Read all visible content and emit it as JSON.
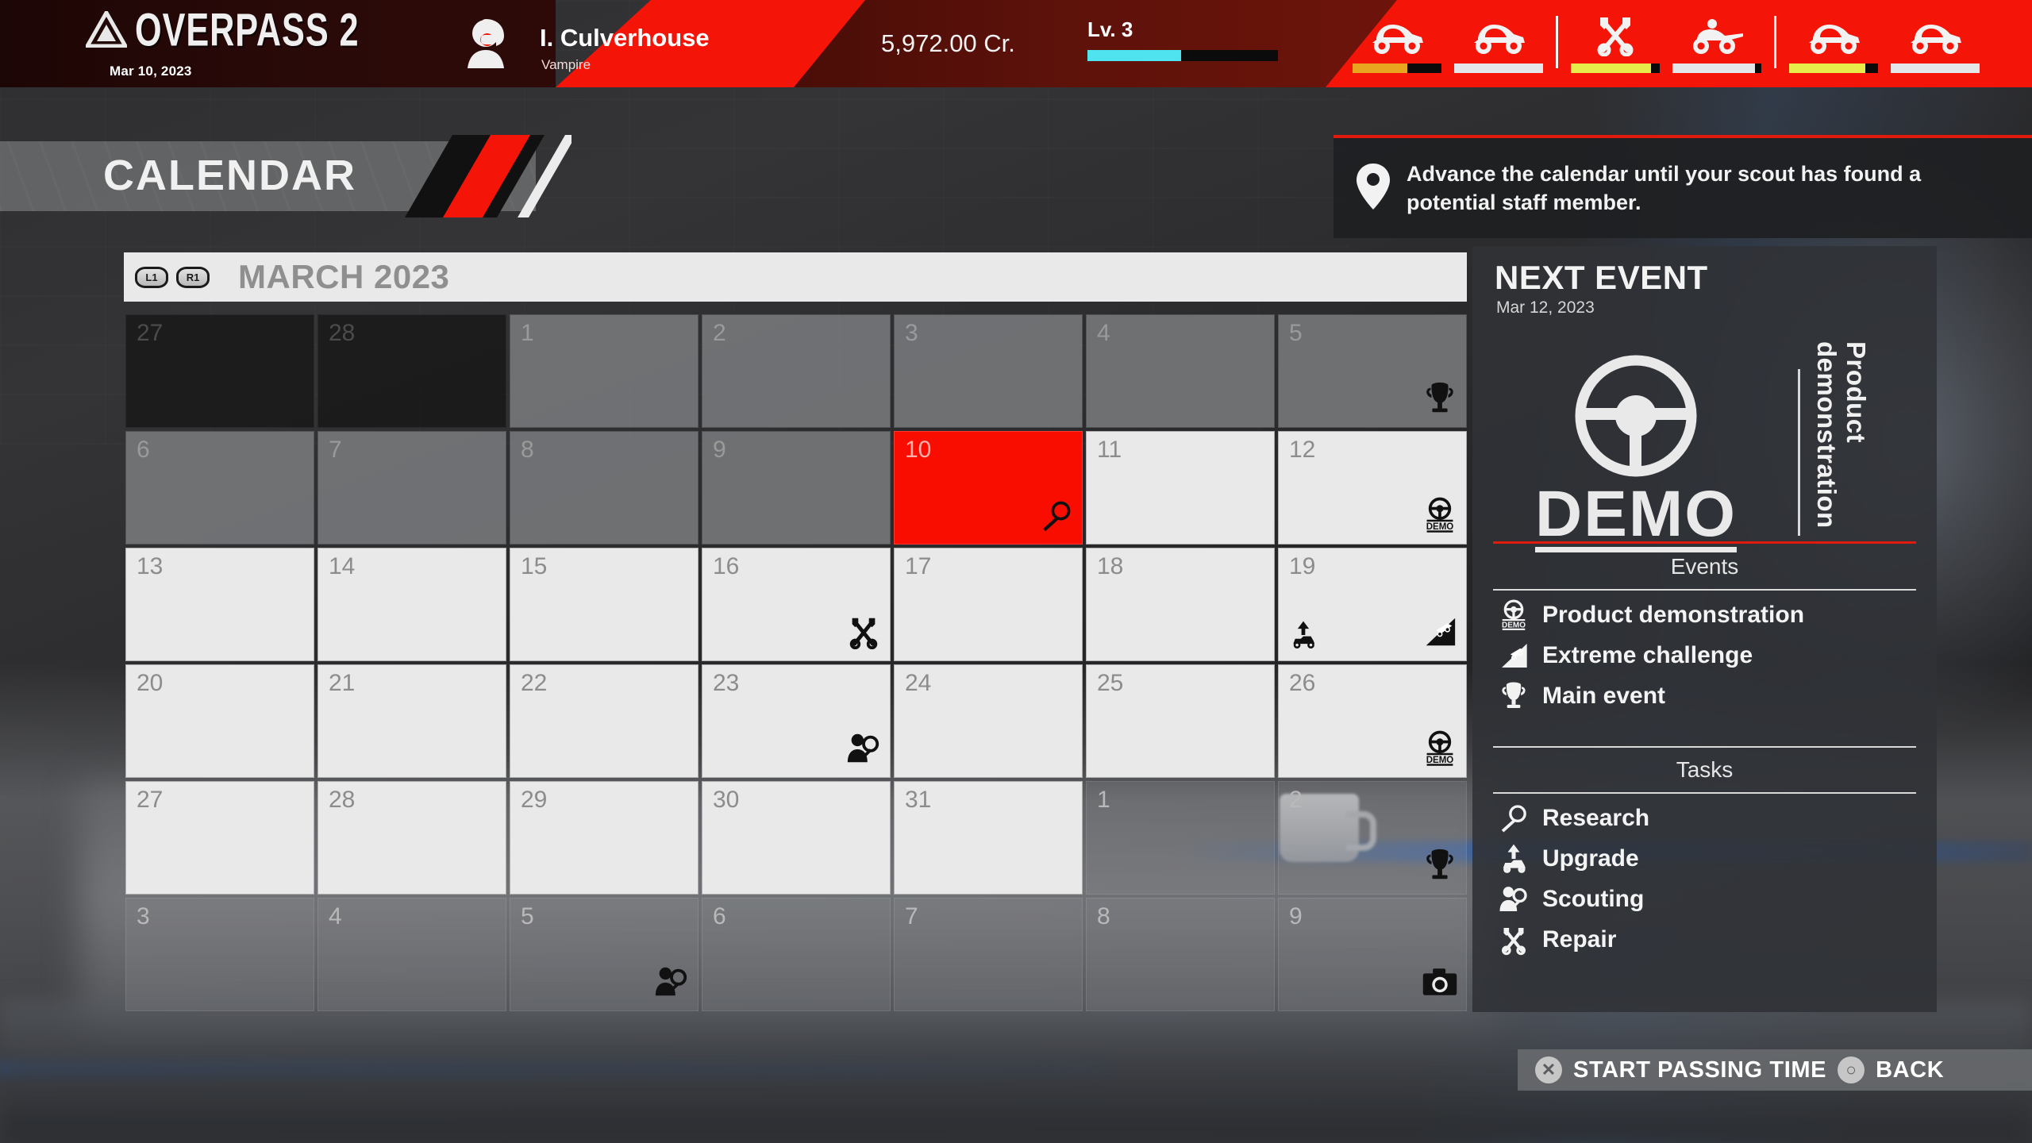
{
  "header": {
    "game_title": "OVERPASS 2",
    "date": "Mar 10, 2023",
    "player_name": "I. Culverhouse",
    "player_team": "Vampire",
    "credits": "5,972.00 Cr.",
    "level_label": "Lv. 3",
    "level_progress": 49,
    "logo_icon": "mountain-triangle-icon",
    "player_icon": "driver-helmet-icon",
    "vehicles": [
      {
        "icon": "buggy-icon",
        "name": "vehicle-buggy-1",
        "bar_color": "#e8a520",
        "bar_fill": 62
      },
      {
        "icon": "buggy-icon",
        "name": "vehicle-buggy-2",
        "bar_color": "#e4e6ea",
        "bar_fill": 100
      },
      {
        "icon": "wrench-tools-icon",
        "name": "vehicle-repair",
        "bar_color": "#e8ec4a",
        "bar_fill": 90
      },
      {
        "icon": "quad-atv-icon",
        "name": "vehicle-quad",
        "bar_color": "#e4e6ea",
        "bar_fill": 93
      },
      {
        "icon": "buggy-icon",
        "name": "vehicle-buggy-3",
        "bar_color": "#e8ec4a",
        "bar_fill": 86
      },
      {
        "icon": "buggy-icon",
        "name": "vehicle-buggy-4",
        "bar_color": "#e4e6ea",
        "bar_fill": 100
      }
    ]
  },
  "calendar": {
    "page_title": "CALENDAR",
    "prev_bumper": "L1",
    "next_bumper": "R1",
    "month_label": "MARCH 2023",
    "cells": [
      {
        "num": "27",
        "state": "outside",
        "icon": ""
      },
      {
        "num": "28",
        "state": "outside",
        "icon": ""
      },
      {
        "num": "1",
        "state": "past",
        "icon": ""
      },
      {
        "num": "2",
        "state": "past",
        "icon": ""
      },
      {
        "num": "3",
        "state": "past",
        "icon": ""
      },
      {
        "num": "4",
        "state": "past",
        "icon": ""
      },
      {
        "num": "5",
        "state": "past",
        "icon": "trophy-icon"
      },
      {
        "num": "6",
        "state": "past",
        "icon": ""
      },
      {
        "num": "7",
        "state": "past",
        "icon": ""
      },
      {
        "num": "8",
        "state": "past",
        "icon": ""
      },
      {
        "num": "9",
        "state": "past",
        "icon": ""
      },
      {
        "num": "10",
        "state": "today",
        "icon": "research-magnifier-icon"
      },
      {
        "num": "11",
        "state": "future",
        "icon": ""
      },
      {
        "num": "12",
        "state": "future",
        "icon": "demo-steering-wheel-icon"
      },
      {
        "num": "13",
        "state": "future",
        "icon": ""
      },
      {
        "num": "14",
        "state": "future",
        "icon": ""
      },
      {
        "num": "15",
        "state": "future",
        "icon": ""
      },
      {
        "num": "16",
        "state": "future",
        "icon": "repair-tools-icon"
      },
      {
        "num": "17",
        "state": "future",
        "icon": ""
      },
      {
        "num": "18",
        "state": "future",
        "icon": ""
      },
      {
        "num": "19",
        "state": "future",
        "icon": "extreme-challenge-icon",
        "icon2": "upgrade-icon"
      },
      {
        "num": "20",
        "state": "future",
        "icon": ""
      },
      {
        "num": "21",
        "state": "future",
        "icon": ""
      },
      {
        "num": "22",
        "state": "future",
        "icon": ""
      },
      {
        "num": "23",
        "state": "future",
        "icon": "scouting-icon"
      },
      {
        "num": "24",
        "state": "future",
        "icon": ""
      },
      {
        "num": "25",
        "state": "future",
        "icon": ""
      },
      {
        "num": "26",
        "state": "future",
        "icon": "demo-steering-wheel-icon"
      },
      {
        "num": "27",
        "state": "future",
        "icon": ""
      },
      {
        "num": "28",
        "state": "future",
        "icon": ""
      },
      {
        "num": "29",
        "state": "future",
        "icon": ""
      },
      {
        "num": "30",
        "state": "future",
        "icon": ""
      },
      {
        "num": "31",
        "state": "future",
        "icon": ""
      },
      {
        "num": "1",
        "state": "outside-late",
        "icon": ""
      },
      {
        "num": "2",
        "state": "outside-late",
        "icon": "trophy-icon"
      },
      {
        "num": "3",
        "state": "outside-late",
        "icon": ""
      },
      {
        "num": "4",
        "state": "outside-late",
        "icon": ""
      },
      {
        "num": "5",
        "state": "outside-late",
        "icon": "scouting-icon"
      },
      {
        "num": "6",
        "state": "outside-late",
        "icon": ""
      },
      {
        "num": "7",
        "state": "outside-late",
        "icon": ""
      },
      {
        "num": "8",
        "state": "outside-late",
        "icon": ""
      },
      {
        "num": "9",
        "state": "outside-late",
        "icon": "camera-icon"
      }
    ]
  },
  "hint": {
    "icon": "map-pin-icon",
    "text": "Advance the calendar until your scout has found a potential staff member."
  },
  "panel": {
    "title": "NEXT EVENT",
    "date": "Mar 12, 2023",
    "event_art_label": "DEMO",
    "event_art_icon": "steering-wheel-icon",
    "event_name": "Product demonstration",
    "events_heading": "Events",
    "events": [
      {
        "icon": "demo-steering-wheel-icon",
        "label": "Product demonstration"
      },
      {
        "icon": "extreme-challenge-icon",
        "label": "Extreme challenge"
      },
      {
        "icon": "trophy-icon",
        "label": "Main event"
      }
    ],
    "tasks_heading": "Tasks",
    "tasks": [
      {
        "icon": "research-magnifier-icon",
        "label": "Research"
      },
      {
        "icon": "upgrade-icon",
        "label": "Upgrade"
      },
      {
        "icon": "scouting-icon",
        "label": "Scouting"
      },
      {
        "icon": "repair-tools-icon",
        "label": "Repair"
      }
    ]
  },
  "footer": {
    "primary_glyph": "cross-button-icon",
    "primary_label": "START PASSING TIME",
    "secondary_glyph": "circle-button-icon",
    "secondary_label": "BACK"
  },
  "colors": {
    "accent_red": "#f51408",
    "today_red": "#f90d00",
    "level_cyan": "#4fe2ef",
    "panel_bg": "#303236"
  }
}
